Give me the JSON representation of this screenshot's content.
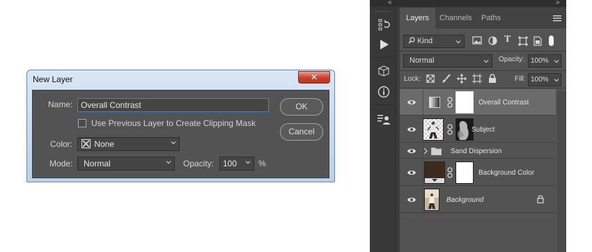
{
  "dialog": {
    "title": "New Layer",
    "close_label": "✕",
    "name_label": "Name:",
    "name_value": "Overall Contrast",
    "clipping_label": "Use Previous Layer to Create Clipping Mask",
    "clipping_checked": false,
    "color_label": "Color:",
    "color_value": "None",
    "mode_label": "Mode:",
    "mode_value": "Normal",
    "opacity_label": "Opacity:",
    "opacity_value": "100",
    "opacity_unit": "%",
    "ok_label": "OK",
    "cancel_label": "Cancel"
  },
  "panel": {
    "collapse_icon": "«",
    "expand_icon": "»",
    "tabs": [
      {
        "label": "Layers",
        "active": true
      },
      {
        "label": "Channels",
        "active": false
      },
      {
        "label": "Paths",
        "active": false
      }
    ],
    "filter": {
      "kind_label": "Kind"
    },
    "blend_mode": "Normal",
    "opacity_label": "Opacity:",
    "opacity_value": "100%",
    "lock_label": "Lock:",
    "fill_label": "Fill:",
    "fill_value": "100%",
    "layers": [
      {
        "name": "Overall Contrast",
        "selected": true,
        "type": "adjustment"
      },
      {
        "name": "Subject",
        "selected": false,
        "type": "masked-image"
      },
      {
        "name": "Sand Dispersion",
        "selected": false,
        "type": "group"
      },
      {
        "name": "Background Color",
        "selected": false,
        "type": "fill"
      },
      {
        "name": "Background",
        "selected": false,
        "type": "background",
        "locked": true
      }
    ]
  },
  "colors": {
    "panel_bg": "#535353",
    "selected_row": "#6b6b6b",
    "dialog_titlebar": "#c9daf0",
    "close_red": "#c7402b",
    "fill_swatch": "#3e2a1c"
  }
}
